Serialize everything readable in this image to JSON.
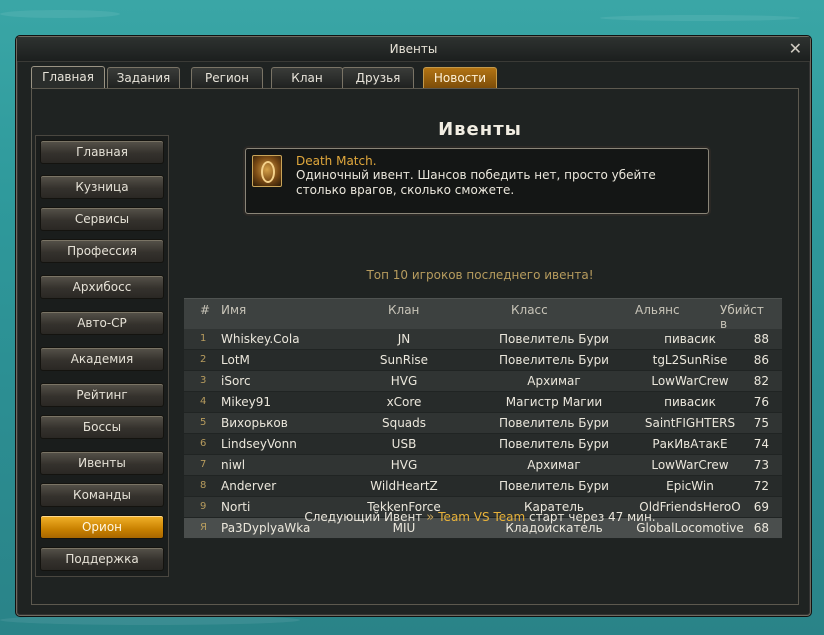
{
  "window": {
    "title": "Ивенты"
  },
  "tabs": [
    {
      "label": "Главная",
      "active": true
    },
    {
      "label": "Задания"
    },
    {
      "label": "Регион"
    },
    {
      "label": "Клан"
    },
    {
      "label": "Друзья"
    },
    {
      "label": "Новости",
      "highlight": true
    }
  ],
  "sidebar": {
    "items": [
      {
        "label": "Главная"
      },
      {
        "label": "Кузница"
      },
      {
        "label": "Сервисы"
      },
      {
        "label": "Профессия"
      },
      {
        "label": "Архибосс"
      },
      {
        "label": "Авто-СР"
      },
      {
        "label": "Академия"
      },
      {
        "label": "Рейтинг"
      },
      {
        "label": "Боссы"
      },
      {
        "label": "Ивенты"
      },
      {
        "label": "Команды"
      },
      {
        "label": "Орион",
        "active": true
      },
      {
        "label": "Поддержка"
      }
    ]
  },
  "main": {
    "title": "Ивенты",
    "event": {
      "icon": "event-emblem-icon",
      "name": "Death Match.",
      "description": " Одиночный ивент. Шансов победить нет, просто убейте столько врагов, сколько сможете."
    },
    "top_title": "Топ 10 игроков последнего ивента!",
    "table": {
      "headers": {
        "rank": "#",
        "name": "Имя",
        "clan": "Клан",
        "class": "Класс",
        "alliance": "Альянс",
        "kills": "Убийств"
      },
      "rows": [
        {
          "rank": "1",
          "name": "Whiskey.Cola",
          "clan": "JN",
          "class": "Повелитель Бури",
          "alliance": "пивасик",
          "kills": "88"
        },
        {
          "rank": "2",
          "name": "LotM",
          "clan": "SunRise",
          "class": "Повелитель Бури",
          "alliance": "tgL2SunRise",
          "kills": "86"
        },
        {
          "rank": "3",
          "name": "iSorc",
          "clan": "HVG",
          "class": "Архимаг",
          "alliance": "LowWarCrew",
          "kills": "82"
        },
        {
          "rank": "4",
          "name": "Mikey91",
          "clan": "xCore",
          "class": "Магистр Магии",
          "alliance": "пивасик",
          "kills": "76"
        },
        {
          "rank": "5",
          "name": "Вихорьков",
          "clan": "Squads",
          "class": "Повелитель Бури",
          "alliance": "SaintFIGHTERS",
          "kills": "75"
        },
        {
          "rank": "6",
          "name": "LindseyVonn",
          "clan": "USB",
          "class": "Повелитель Бури",
          "alliance": "РакИвАтакЕ",
          "kills": "74"
        },
        {
          "rank": "7",
          "name": "niwl",
          "clan": "HVG",
          "class": "Архимаг",
          "alliance": "LowWarCrew",
          "kills": "73"
        },
        {
          "rank": "8",
          "name": "Anderver",
          "clan": "WildHeartZ",
          "class": "Повелитель Бури",
          "alliance": "EpicWin",
          "kills": "72"
        },
        {
          "rank": "9",
          "name": "Norti",
          "clan": "TekkenForce",
          "class": "Каратель",
          "alliance": "OldFriendsHeroO",
          "kills": "69"
        },
        {
          "rank": "Я",
          "name": "Pa3DyplyaWka",
          "clan": "MIU",
          "class": "Кладоискатель",
          "alliance": "GlobalLocomotive",
          "kills": "68"
        }
      ]
    },
    "next_event": {
      "label": "Следующий Ивент",
      "arrows": "»",
      "event_name": "Team VS Team",
      "suffix": "старт через 47 мин."
    }
  },
  "colors": {
    "accent_orange": "#c98100",
    "gold_text": "#e8b23a",
    "water": "#2f9a9c"
  }
}
